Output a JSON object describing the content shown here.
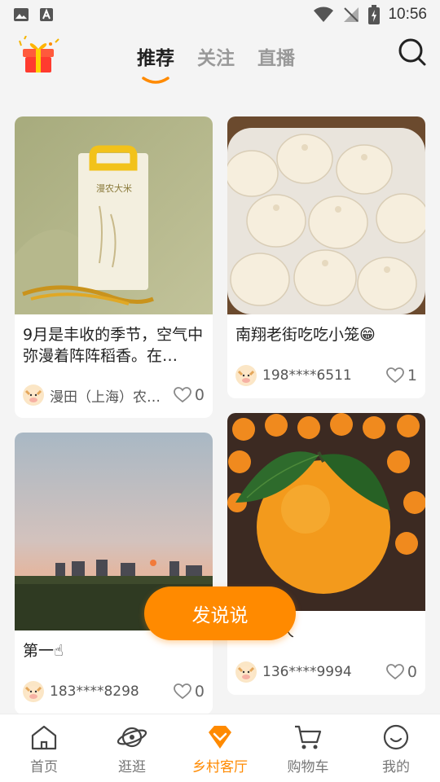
{
  "status_bar": {
    "time": "10:56"
  },
  "tabs": [
    {
      "label": "推荐",
      "active": true
    },
    {
      "label": "关注",
      "active": false
    },
    {
      "label": "直播",
      "active": false
    }
  ],
  "posts": [
    {
      "title": "9月是丰收的季节，空气中弥漫着阵阵稻香。在…",
      "author": "漫田（上海）农…",
      "likes": "0",
      "image": "rice-package-photo"
    },
    {
      "title": "南翔老街吃吃小笼😁",
      "author": "198****6511",
      "likes": "1",
      "image": "soup-dumplings-photo"
    },
    {
      "title": "第一☝",
      "author": "183****8298",
      "likes": "0",
      "image": "sunset-field-photo"
    },
    {
      "title": "美人",
      "author": "136****9994",
      "likes": "0",
      "image": "orange-photo"
    }
  ],
  "fab_label": "发说说",
  "bottom_nav": [
    {
      "label": "首页",
      "icon": "home-icon"
    },
    {
      "label": "逛逛",
      "icon": "planet-icon"
    },
    {
      "label": "乡村客厅",
      "icon": "diamond-icon",
      "active": true
    },
    {
      "label": "购物车",
      "icon": "cart-icon"
    },
    {
      "label": "我的",
      "icon": "smile-icon"
    }
  ],
  "colors": {
    "accent": "#ff8a00",
    "background": "#f4f4f4"
  }
}
